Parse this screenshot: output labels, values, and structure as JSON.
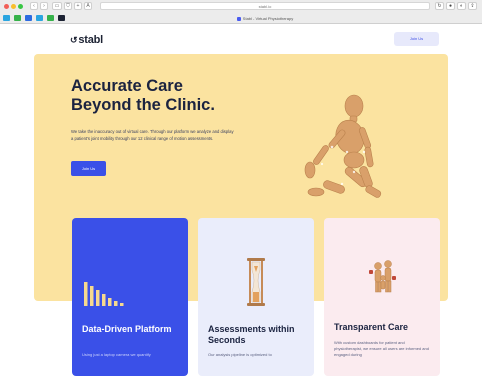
{
  "browser": {
    "address": "stabl.io",
    "tab_title": "Stabl - Virtual Physiotherapy"
  },
  "header": {
    "logo": "stabl",
    "join_label": "Join Us"
  },
  "hero": {
    "title_line1": "Accurate Care",
    "title_line2": "Beyond the Clinic.",
    "body": "We take the inaccuracy out of virtual care. Through our platform we analyze and display a patient's joint mobility through our 12 clinical range of motion assessments.",
    "join_label": "Join Us"
  },
  "cards": [
    {
      "title": "Data-Driven Platform",
      "body": "Using just a laptop camera we quantify"
    },
    {
      "title": "Assessments within Seconds",
      "body": "Our analysis pipeline is optimized to"
    },
    {
      "title": "Transparent Care",
      "body": "With custom dashboards for patient and physiotherapist, we ensure all users are informed and engaged during"
    }
  ],
  "colors": {
    "accent": "#3a50e8",
    "hero_bg": "#fbe3a0",
    "text_dark": "#1b2340"
  }
}
